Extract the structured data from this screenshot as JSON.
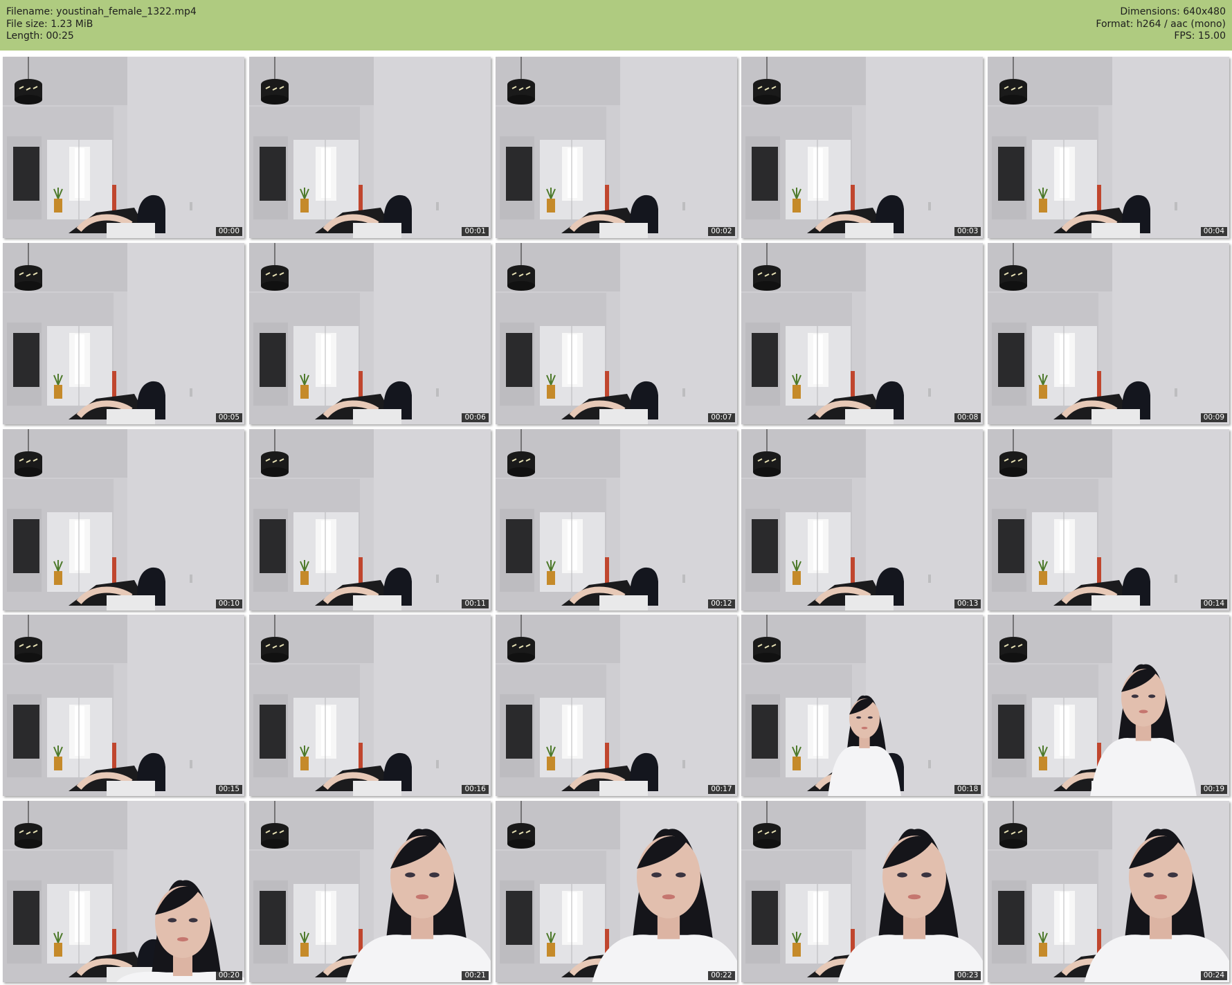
{
  "header": {
    "filename_line": "Filename: youstinah_female_1322.mp4",
    "filesize_line": "File size: 1.23 MiB",
    "length_line": "Length: 00:25",
    "dimensions_line": "Dimensions: 640x480",
    "format_line": "Format: h264 / aac (mono)",
    "fps_line": "FPS: 15.00"
  },
  "colors": {
    "header_bg": "#afcb80",
    "frame_bg": "#c9c8cc",
    "timestamp_bg": "#141414"
  },
  "frames": [
    {
      "time": "00:00",
      "scene": "empty-room"
    },
    {
      "time": "00:01",
      "scene": "empty-room"
    },
    {
      "time": "00:02",
      "scene": "empty-room"
    },
    {
      "time": "00:03",
      "scene": "empty-room"
    },
    {
      "time": "00:04",
      "scene": "empty-room"
    },
    {
      "time": "00:05",
      "scene": "empty-room"
    },
    {
      "time": "00:06",
      "scene": "empty-room"
    },
    {
      "time": "00:07",
      "scene": "empty-room"
    },
    {
      "time": "00:08",
      "scene": "empty-room"
    },
    {
      "time": "00:09",
      "scene": "empty-room"
    },
    {
      "time": "00:10",
      "scene": "empty-room"
    },
    {
      "time": "00:11",
      "scene": "empty-room"
    },
    {
      "time": "00:12",
      "scene": "empty-room"
    },
    {
      "time": "00:13",
      "scene": "empty-room"
    },
    {
      "time": "00:14",
      "scene": "empty-room"
    },
    {
      "time": "00:15",
      "scene": "empty-room"
    },
    {
      "time": "00:16",
      "scene": "empty-room"
    },
    {
      "time": "00:17",
      "scene": "empty-room"
    },
    {
      "time": "00:18",
      "scene": "person-far"
    },
    {
      "time": "00:19",
      "scene": "person-mid"
    },
    {
      "time": "00:20",
      "scene": "person-close-left"
    },
    {
      "time": "00:21",
      "scene": "person-close"
    },
    {
      "time": "00:22",
      "scene": "person-close"
    },
    {
      "time": "00:23",
      "scene": "person-close"
    },
    {
      "time": "00:24",
      "scene": "person-close"
    }
  ]
}
